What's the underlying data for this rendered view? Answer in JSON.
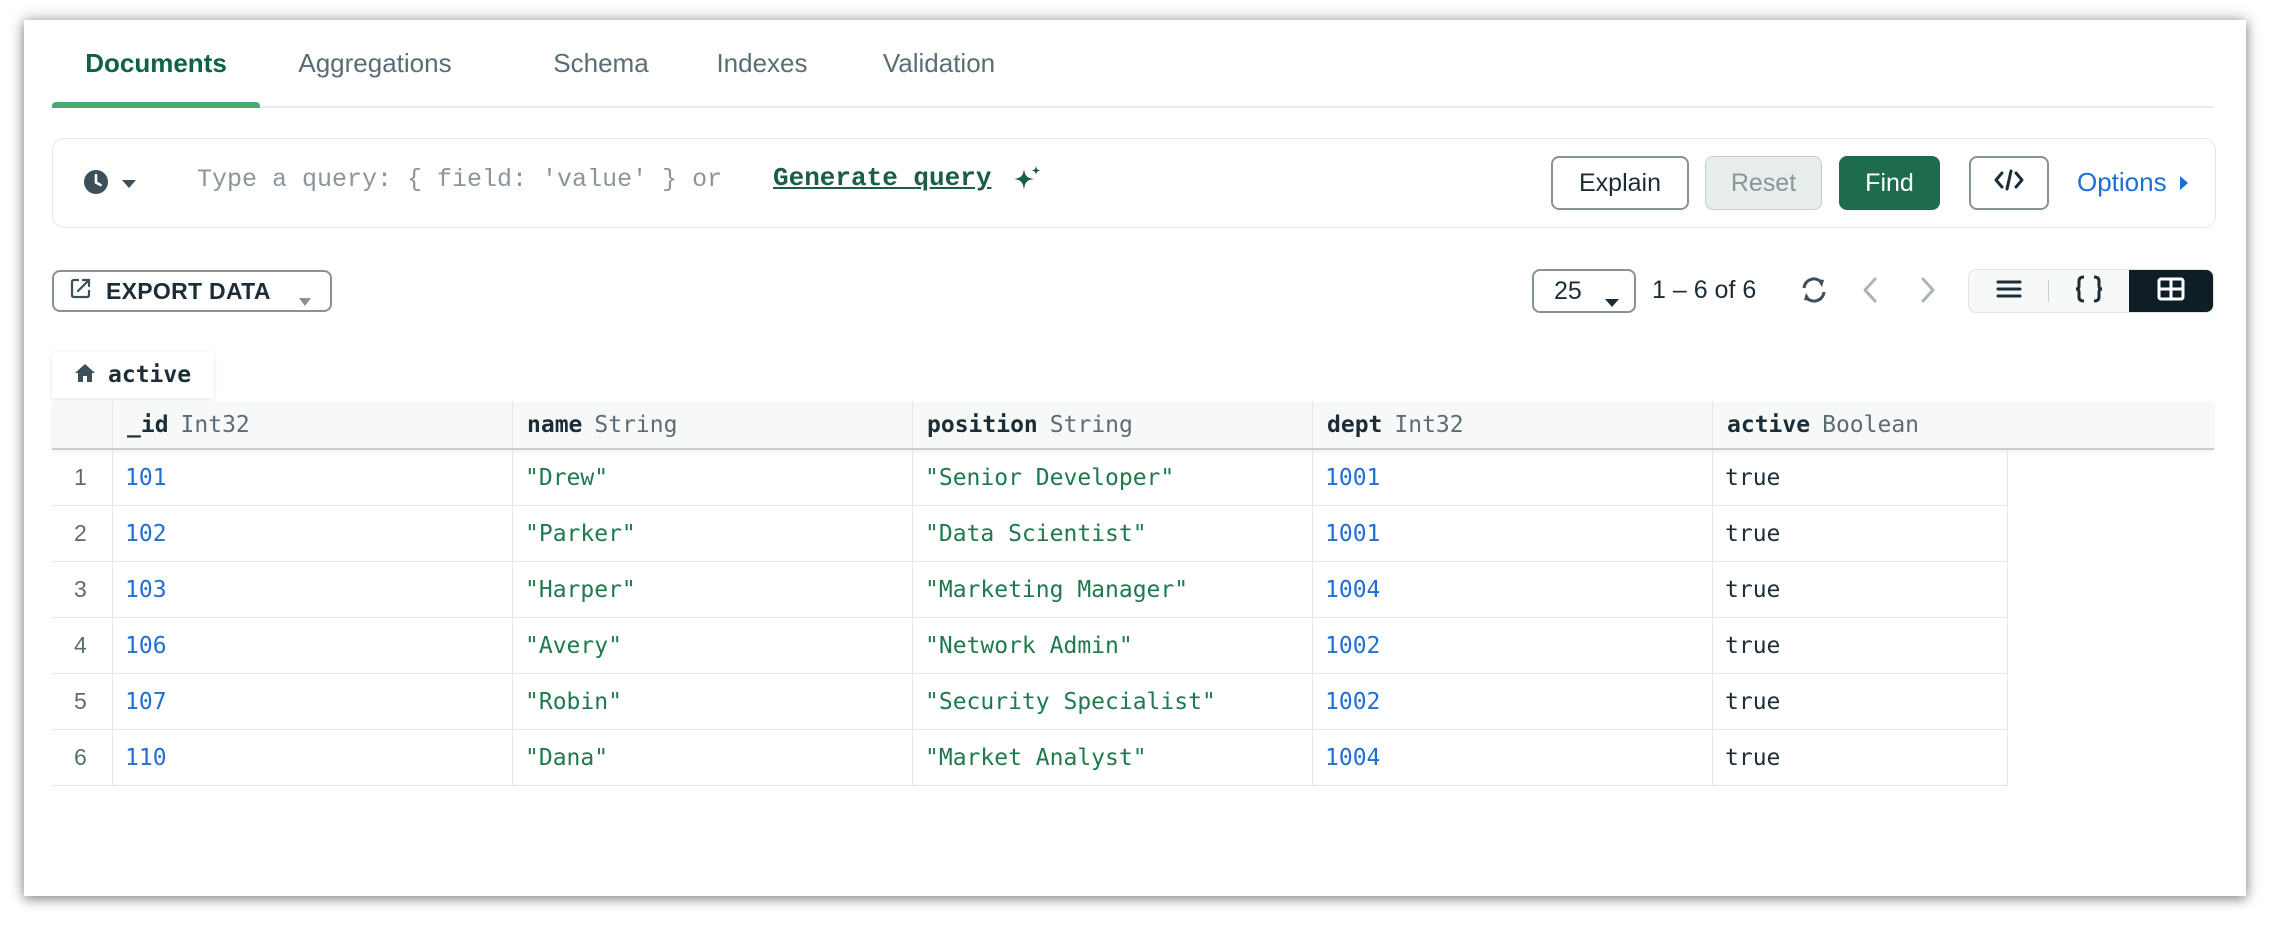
{
  "tabs": [
    {
      "label": "Documents",
      "active": true
    },
    {
      "label": "Aggregations"
    },
    {
      "label": "Schema"
    },
    {
      "label": "Indexes"
    },
    {
      "label": "Validation"
    }
  ],
  "query": {
    "placeholder": "Type a query: { field: 'value' } or",
    "generate_label": "Generate query",
    "buttons": {
      "explain": "Explain",
      "reset": "Reset",
      "find": "Find",
      "options": "Options"
    }
  },
  "toolbar": {
    "export_label": "EXPORT DATA",
    "page_size": "25",
    "page_count": "1 – 6 of 6"
  },
  "breadcrumb": {
    "label": "active"
  },
  "grid": {
    "columns": [
      {
        "name": "_id",
        "type": "Int32"
      },
      {
        "name": "name",
        "type": "String"
      },
      {
        "name": "position",
        "type": "String"
      },
      {
        "name": "dept",
        "type": "Int32"
      },
      {
        "name": "active",
        "type": "Boolean"
      }
    ],
    "rows": [
      {
        "index": "1",
        "id": "101",
        "name": "\"Drew\"",
        "position": "\"Senior Developer\"",
        "dept": "1001",
        "active": "true"
      },
      {
        "index": "2",
        "id": "102",
        "name": "\"Parker\"",
        "position": "\"Data Scientist\"",
        "dept": "1001",
        "active": "true"
      },
      {
        "index": "3",
        "id": "103",
        "name": "\"Harper\"",
        "position": "\"Marketing Manager\"",
        "dept": "1004",
        "active": "true"
      },
      {
        "index": "4",
        "id": "106",
        "name": "\"Avery\"",
        "position": "\"Network Admin\"",
        "dept": "1002",
        "active": "true"
      },
      {
        "index": "5",
        "id": "107",
        "name": "\"Robin\"",
        "position": "\"Security Specialist\"",
        "dept": "1002",
        "active": "true"
      },
      {
        "index": "6",
        "id": "110",
        "name": "\"Dana\"",
        "position": "\"Market Analyst\"",
        "dept": "1004",
        "active": "true"
      }
    ]
  },
  "icons": {
    "history": "clock-icon",
    "generate": "sparkle-icon",
    "code": "code-icon",
    "options": "caret-right-icon",
    "export": "export-icon",
    "refresh": "refresh-icon",
    "prev": "chevron-left-icon",
    "next": "chevron-right-icon",
    "list_view": "list-view-icon",
    "json_view": "json-view-icon",
    "table_view": "table-view-icon",
    "breadcrumb": "home-icon"
  },
  "colors": {
    "accent_green": "#1f6b4e",
    "tab_active": "#116149",
    "tab_underline": "#4ca870",
    "link_blue": "#1c6fd6",
    "number_blue": "#1f6fd6",
    "string_green": "#1e7a4d"
  }
}
